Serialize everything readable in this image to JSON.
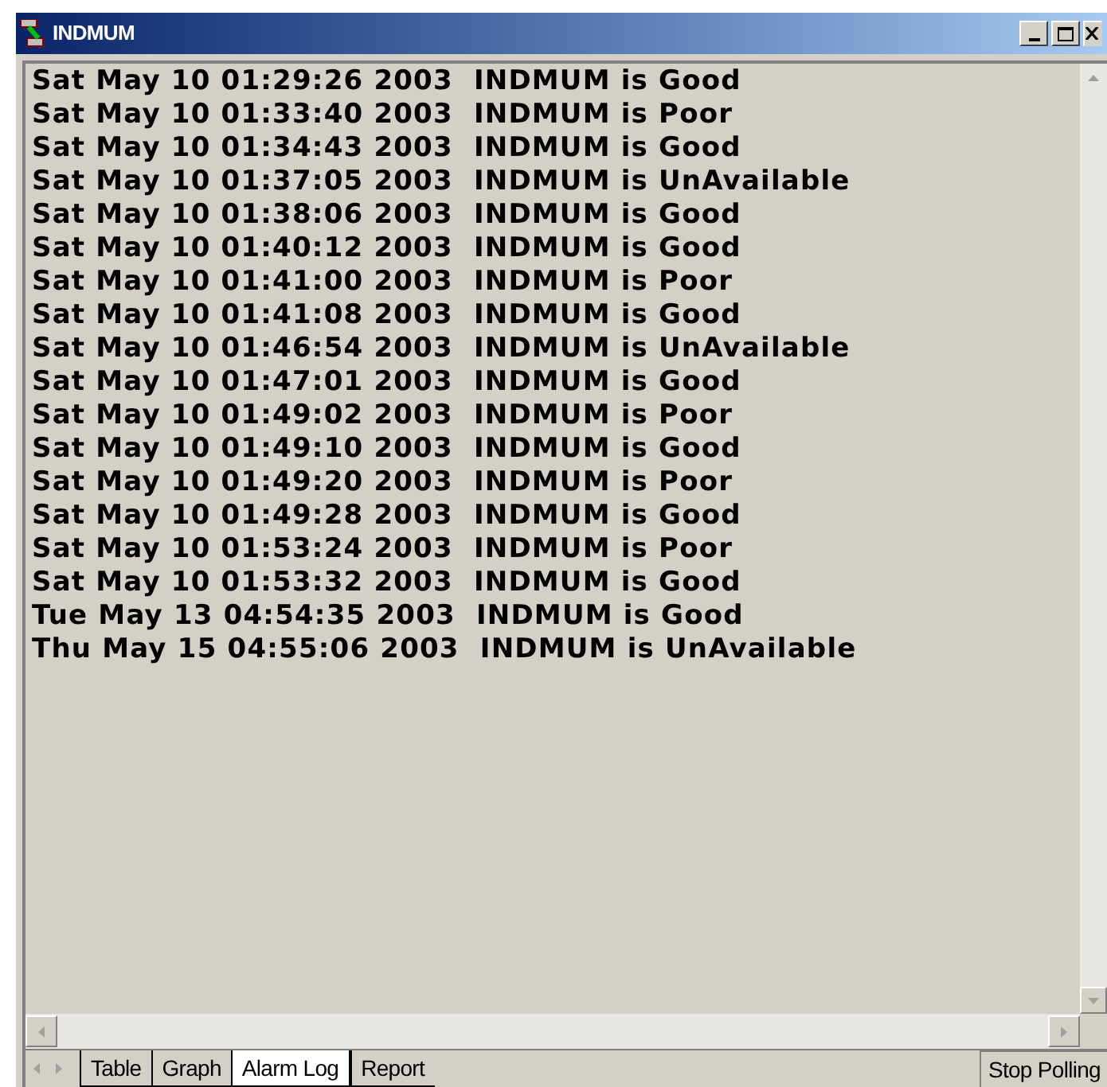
{
  "window": {
    "title": "INDMUM"
  },
  "log_lines": [
    "Sat May 10 01:29:26 2003  INDMUM is Good",
    "Sat May 10 01:33:40 2003  INDMUM is Poor",
    "Sat May 10 01:34:43 2003  INDMUM is Good",
    "Sat May 10 01:37:05 2003  INDMUM is UnAvailable",
    "Sat May 10 01:38:06 2003  INDMUM is Good",
    "Sat May 10 01:40:12 2003  INDMUM is Good",
    "Sat May 10 01:41:00 2003  INDMUM is Poor",
    "Sat May 10 01:41:08 2003  INDMUM is Good",
    "Sat May 10 01:46:54 2003  INDMUM is UnAvailable",
    "Sat May 10 01:47:01 2003  INDMUM is Good",
    "Sat May 10 01:49:02 2003  INDMUM is Poor",
    "Sat May 10 01:49:10 2003  INDMUM is Good",
    "Sat May 10 01:49:20 2003  INDMUM is Poor",
    "Sat May 10 01:49:28 2003  INDMUM is Good",
    "Sat May 10 01:53:24 2003  INDMUM is Poor",
    "Sat May 10 01:53:32 2003  INDMUM is Good",
    "Tue May 13 04:54:35 2003  INDMUM is Good",
    "Thu May 15 04:55:06 2003  INDMUM is UnAvailable"
  ],
  "tabs": [
    {
      "label": "Table",
      "selected": false
    },
    {
      "label": "Graph",
      "selected": false
    },
    {
      "label": "Alarm Log",
      "selected": true
    },
    {
      "label": "Report",
      "selected": false
    }
  ],
  "stop_button": "Stop Polling"
}
